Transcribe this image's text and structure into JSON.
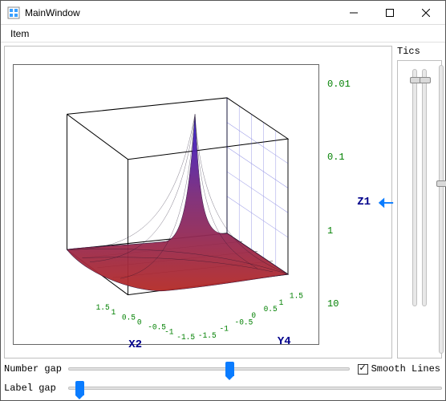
{
  "window": {
    "title": "MainWindow",
    "icon_name": "app-icon"
  },
  "menubar": {
    "items": [
      {
        "label": "Item"
      }
    ]
  },
  "side": {
    "tics_label": "Tics",
    "vslider1_pos_pct": 3,
    "vslider2_pos_pct": 3,
    "edge_slider_pos_pct": 40
  },
  "sliders": {
    "number_gap": {
      "label": "Number gap",
      "pos_pct": 56
    },
    "label_gap": {
      "label": "Label gap",
      "pos_pct": 2
    }
  },
  "checkbox": {
    "label": "Smooth Lines",
    "checked": true,
    "check_glyph": "✓"
  },
  "chart_data": {
    "type": "surface3d",
    "axes": {
      "x": {
        "label": "X2",
        "ticks": [
          -1.5,
          -1,
          -0.5,
          0,
          0.5,
          1,
          1.5
        ],
        "range": [
          -1.5,
          1.5
        ]
      },
      "y": {
        "label": "Y4",
        "ticks": [
          -1.5,
          -1,
          -0.5,
          0,
          0.5,
          1,
          1.5
        ],
        "range": [
          -1.5,
          1.5
        ]
      },
      "z": {
        "label": "Z1",
        "ticks": [
          0.01,
          0.1,
          1,
          10
        ],
        "scale": "log",
        "range": [
          0.01,
          10
        ]
      }
    },
    "annotations": [],
    "series": [
      {
        "name": "surface",
        "color_low": "#b52b27",
        "color_high": "#2e1bd8",
        "description": "sharp spike near (x≈0,y≈0), decays outward; log-scaled Z"
      }
    ],
    "derived_labels": {
      "z_tick_labels": [
        "0.01",
        "0.1",
        "1",
        "10"
      ],
      "x_tick_labels": [
        "-1.5",
        "-1",
        "-0.5",
        "0",
        "0.5",
        "1",
        "1.5"
      ],
      "y_tick_labels": [
        "-1.5",
        "-1",
        "-0.5",
        "0",
        "0.5",
        "1",
        "1.5"
      ]
    }
  }
}
